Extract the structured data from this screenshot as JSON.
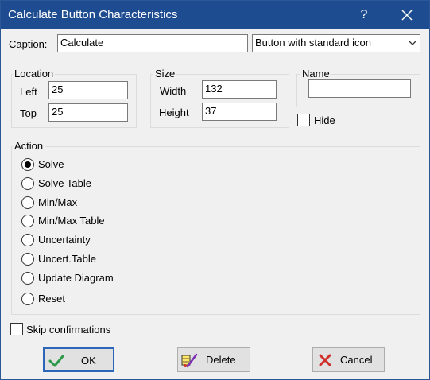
{
  "window": {
    "title": "Calculate Button Characteristics",
    "help_glyph": "?"
  },
  "caption": {
    "label": "Caption:",
    "value": "Calculate",
    "style_selected": "Button with standard icon"
  },
  "location": {
    "title": "Location",
    "left_label": "Left",
    "left_value": "25",
    "top_label": "Top",
    "top_value": "25"
  },
  "size": {
    "title": "Size",
    "width_label": "Width",
    "width_value": "132",
    "height_label": "Height",
    "height_value": "37"
  },
  "name": {
    "title": "Name",
    "value": ""
  },
  "hide": {
    "label": "Hide",
    "checked": false
  },
  "action": {
    "title": "Action",
    "options": [
      {
        "label": "Solve",
        "selected": true
      },
      {
        "label": "Solve Table",
        "selected": false
      },
      {
        "label": "Min/Max",
        "selected": false
      },
      {
        "label": "Min/Max Table",
        "selected": false
      },
      {
        "label": "Uncertainty",
        "selected": false
      },
      {
        "label": "Uncert.Table",
        "selected": false
      },
      {
        "label": "Update Diagram",
        "selected": false
      },
      {
        "label": "Reset",
        "selected": false
      }
    ]
  },
  "skip_confirmations": {
    "label": "Skip confirmations",
    "checked": false
  },
  "buttons": {
    "ok_label": "OK",
    "delete_label": "Delete",
    "cancel_label": "Cancel"
  },
  "icons": {
    "ok": "checkmark-icon",
    "delete": "delete-icon",
    "cancel": "red-x-icon",
    "close": "close-icon",
    "dropdown": "chevron-down-icon"
  },
  "colors": {
    "titlebar": "#1e4c91",
    "ok_check": "#2e9a4a",
    "cancel_x": "#d0312d",
    "default_button_border": "#2c66b8"
  }
}
